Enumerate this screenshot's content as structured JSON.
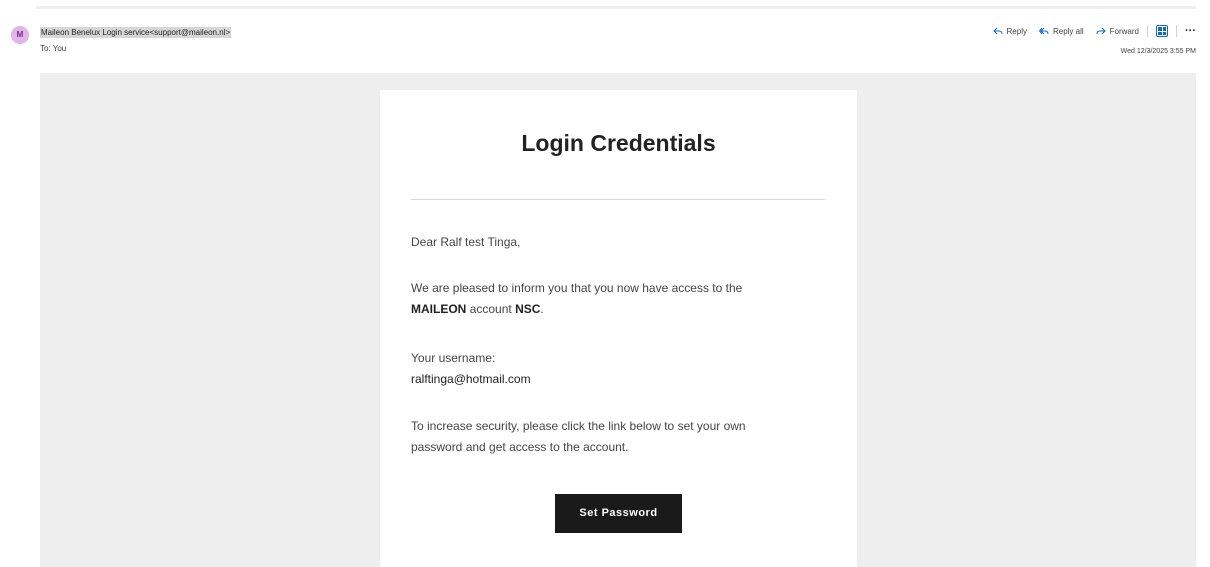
{
  "header": {
    "avatar_initial": "M",
    "sender": "Maileon Benelux Login service<support@maileon.nl>",
    "to_line": "To: You",
    "date": "Wed 12/3/2025 3:55 PM",
    "actions": {
      "reply": "Reply",
      "reply_all": "Reply all",
      "forward": "Forward",
      "more": "···"
    },
    "accent_color": "#0f6cbd"
  },
  "email": {
    "title": "Login Credentials",
    "greeting": "Dear Ralf test Tinga,",
    "access_text": "We are pleased to inform you that you now have access to the",
    "account_name": "MAILEON",
    "account_word": "account",
    "account_id": "NSC",
    "username_label": "Your username:",
    "username": "ralftinga@hotmail.com",
    "security_text_1": "To increase security, please click the link below to set your own",
    "security_text_2": "password and get access to the account.",
    "button_label": "Set Password"
  }
}
